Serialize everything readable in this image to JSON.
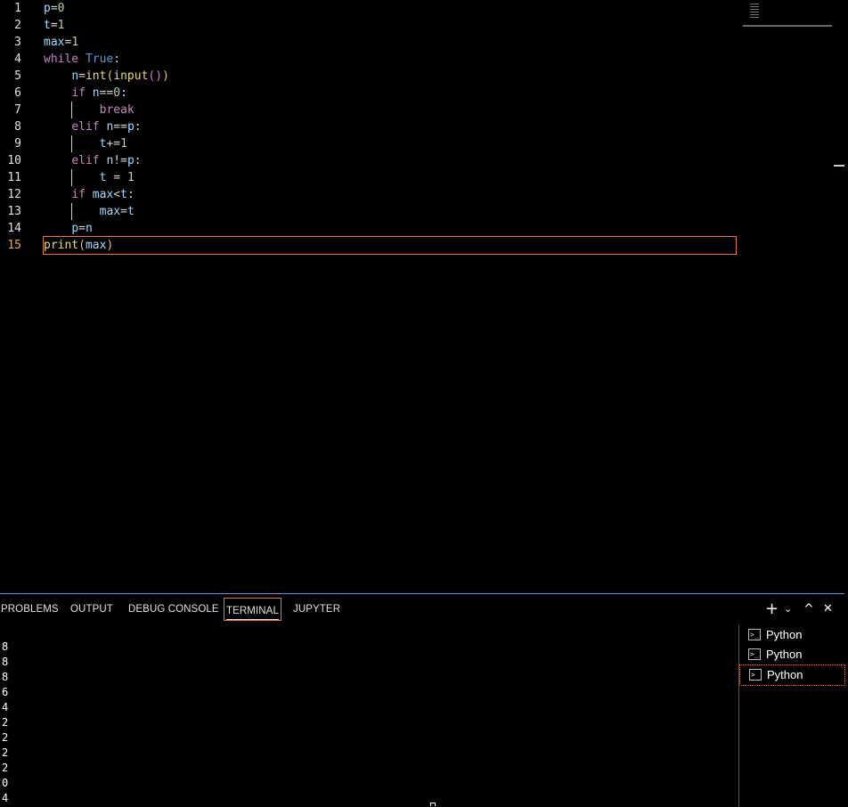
{
  "editor": {
    "line_numbers": [
      "1",
      "2",
      "3",
      "4",
      "5",
      "6",
      "7",
      "8",
      "9",
      "10",
      "11",
      "12",
      "13",
      "14",
      "15"
    ],
    "lines": [
      {
        "text": "p=0"
      },
      {
        "text": "t=1"
      },
      {
        "text": "max=1"
      },
      {
        "text": "while True:"
      },
      {
        "text": "n=int(input())"
      },
      {
        "text": "if n==0:"
      },
      {
        "text": "break"
      },
      {
        "text": "elif n==p:"
      },
      {
        "text": "t+=1"
      },
      {
        "text": "elif n!=p:"
      },
      {
        "text": "t = 1"
      },
      {
        "text": "if max<t:"
      },
      {
        "text": "max=t"
      },
      {
        "text": "p=n"
      },
      {
        "text": "print(max)"
      }
    ]
  },
  "panel": {
    "tabs": [
      "PROBLEMS",
      "OUTPUT",
      "DEBUG CONSOLE",
      "TERMINAL",
      "JUPYTER"
    ],
    "active_tab": "TERMINAL",
    "actions": {
      "add": "+",
      "dropdown": "⌄",
      "maximize": "^",
      "close": "✕"
    },
    "terminal_output": [
      "8",
      "8",
      "8",
      "6",
      "4",
      "2",
      "2",
      "2",
      "2",
      "0",
      "4"
    ],
    "terminals": [
      {
        "label": "Python",
        "icon": "terminal-icon"
      },
      {
        "label": "Python",
        "icon": "terminal-icon"
      },
      {
        "label": "Python",
        "icon": "terminal-icon",
        "selected": true
      }
    ]
  },
  "colors": {
    "accent_orange": "#e07b2a",
    "panel_border": "#6a8fd8",
    "background": "#000000"
  }
}
